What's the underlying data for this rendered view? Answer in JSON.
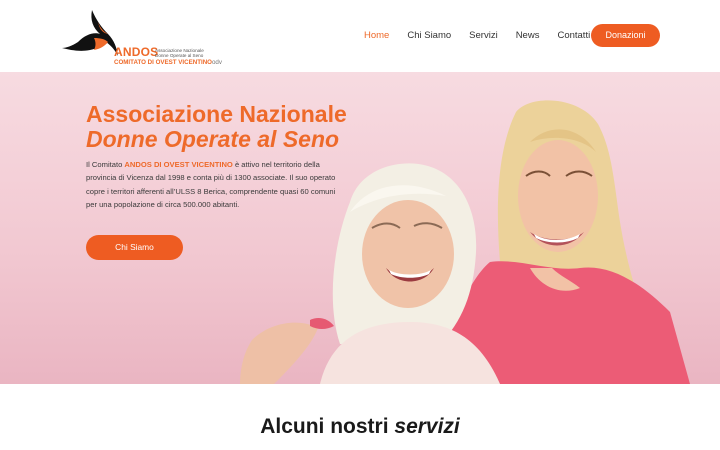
{
  "colors": {
    "brand_orange": "#ee6a2a",
    "button_orange": "#ee5c22",
    "hero_pink": "#f2c9d2"
  },
  "logo": {
    "name": "ANDOS",
    "assoc_lines": [
      "Associazione Nazionale",
      "Donne Operate al Seno"
    ],
    "comitato": "COMITATO DI OVEST VICENTINO",
    "odv": "odv"
  },
  "nav": {
    "items": [
      "Home",
      "Chi Siamo",
      "Servizi",
      "News",
      "Contatti"
    ],
    "active": "Home",
    "donate_label": "Donazioni"
  },
  "hero": {
    "title_line1": "Associazione Nazionale",
    "title_line2": "Donne Operate al Seno",
    "text_prefix": "Il Comitato ",
    "text_bold": "ANDOS DI OVEST VICENTINO",
    "text_suffix": " è attivo nel territorio della provincia di Vicenza dal 1998 e conta più di 1300 associate. Il suo operato copre i territori afferenti all’ULSS 8 Berica, comprendente quasi 60 comuni per una popolazione di circa 500.000 abitanti.",
    "button_label": "Chi Siamo",
    "image_alt": "hero-photo-two-women"
  },
  "services": {
    "title_normal": "Alcuni nostri",
    "title_italic": "servizi"
  }
}
